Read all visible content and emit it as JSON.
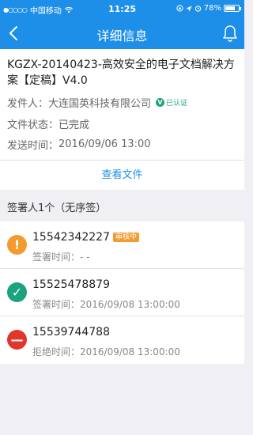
{
  "status_bar": {
    "signal": "●○○○○",
    "carrier": "中国移动",
    "time": "11:25",
    "battery": "78%",
    "battery_level": 0.78
  },
  "nav": {
    "title": "详细信息"
  },
  "document": {
    "title": "KGZX-20140423-高效安全的电子文档解决方案【定稿】V4.0",
    "sender_label": "发件人：",
    "sender": "大连国英科技有限公司",
    "verified_label": "已认证",
    "verified_mark": "V",
    "status_label": "文件状态：",
    "status": "已完成",
    "sent_label": "发送时间：",
    "sent_time": "2016/09/06 13:00",
    "view_file": "查看文件"
  },
  "signers_header": "签署人1个（无序签）",
  "signers": [
    {
      "phone": "15542342227",
      "badge": "审核中",
      "time_label": "签署时间：",
      "time": "- -",
      "icon": "exclamation-icon",
      "color": "#f39b2f",
      "glyph": "!"
    },
    {
      "phone": "15525478879",
      "time_label": "签署时间：",
      "time": "2016/09/08 13:00:00",
      "icon": "check-icon",
      "color": "#1aa37e",
      "glyph": "✓"
    },
    {
      "phone": "15539744788",
      "time_label": "拒绝时间：",
      "time": "2016/09/08 13:00:00",
      "icon": "minus-icon",
      "color": "#e0362c",
      "glyph": "—"
    }
  ]
}
